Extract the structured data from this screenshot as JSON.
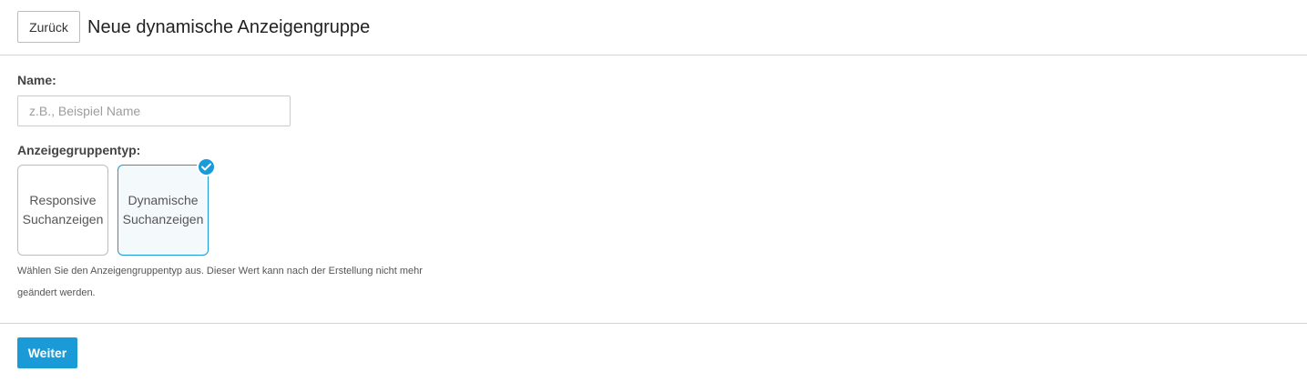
{
  "header": {
    "back_label": "Zurück",
    "title": "Neue dynamische Anzeigengruppe"
  },
  "form": {
    "name_label": "Name:",
    "name_placeholder": "z.B., Beispiel Name",
    "name_value": "",
    "type_label": "Anzeigegruppentyp:",
    "types": [
      {
        "label": "Responsive\nSuchanzeigen",
        "selected": false
      },
      {
        "label": "Dynamische\nSuchanzeigen",
        "selected": true
      }
    ],
    "helper_text": "Wählen Sie den Anzeigengruppentyp aus. Dieser Wert kann nach der Erstellung nicht mehr geändert werden."
  },
  "footer": {
    "next_label": "Weiter"
  },
  "colors": {
    "accent": "#1a9bd7",
    "selected_card_bg": "#f4f9fc",
    "border": "#bdbdbd"
  },
  "icons": {
    "selected_badge": "check-icon"
  }
}
